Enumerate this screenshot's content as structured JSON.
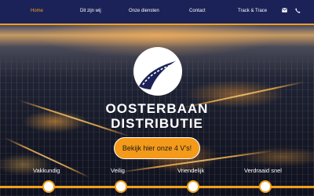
{
  "nav": {
    "items": [
      "Home",
      "Dit zijn wij",
      "Onze diensten",
      "Contact",
      "Track & Trace"
    ],
    "active": "Home",
    "icons": [
      "envelope-icon",
      "phone-icon"
    ]
  },
  "hero": {
    "brand_line1": "OOSTERBAAN",
    "brand_line2": "DISTRIBUTIE",
    "cta_label": "Bekijk hier onze 4 V's!"
  },
  "values": [
    "Vakkundig",
    "Veilig",
    "Vriendelijk",
    "Verdraaid snel"
  ],
  "colors": {
    "nav_bg": "#1b2258",
    "accent": "#f3a01b",
    "text": "#ffffff"
  }
}
